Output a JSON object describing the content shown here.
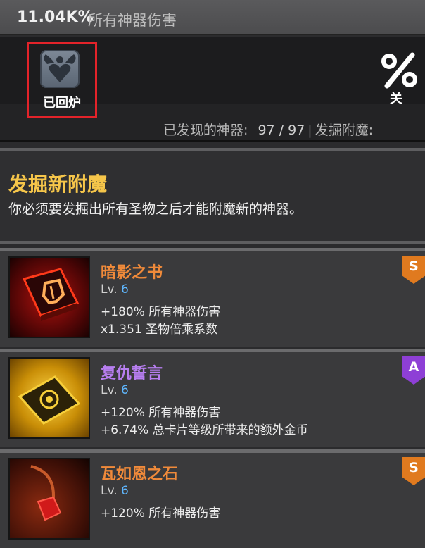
{
  "header": {
    "bonus_value": "11.04K%",
    "bonus_text": "所有神器伤害"
  },
  "furnace": {
    "icon": "heart-wings-icon",
    "label": "已回炉"
  },
  "toggle": {
    "icon": "percent-icon",
    "label": "关"
  },
  "stats": {
    "discovered_label": "已发现的神器:",
    "discovered_value": "97 / 97",
    "enchant_label": "发掘附魔:"
  },
  "notice": {
    "title": "发掘新附魔",
    "body": "你必须要发掘出所有圣物之后才能附魔新的神器。"
  },
  "artifacts": [
    {
      "name": "暗影之书",
      "name_color": "#f08a3a",
      "lv_label": "Lv.",
      "lv": "6",
      "effect1": "+180% 所有神器伤害",
      "effect2": "x1.351 圣物倍乘系数",
      "rank": "S",
      "rank_color": "#e07a1f",
      "icon": "shadow-book-icon"
    },
    {
      "name": "复仇誓言",
      "name_color": "#b77ef0",
      "lv_label": "Lv.",
      "lv": "6",
      "effect1": "+120% 所有神器伤害",
      "effect2": "+6.74% 总卡片等级所带来的额外金币",
      "rank": "A",
      "rank_color": "#8e3fd6",
      "icon": "golden-card-icon"
    },
    {
      "name": "瓦如恩之石",
      "name_color": "#f08a3a",
      "lv_label": "Lv.",
      "lv": "6",
      "effect1": "+120% 所有神器伤害",
      "effect2": "",
      "rank": "S",
      "rank_color": "#e07a1f",
      "icon": "red-stone-icon"
    }
  ]
}
